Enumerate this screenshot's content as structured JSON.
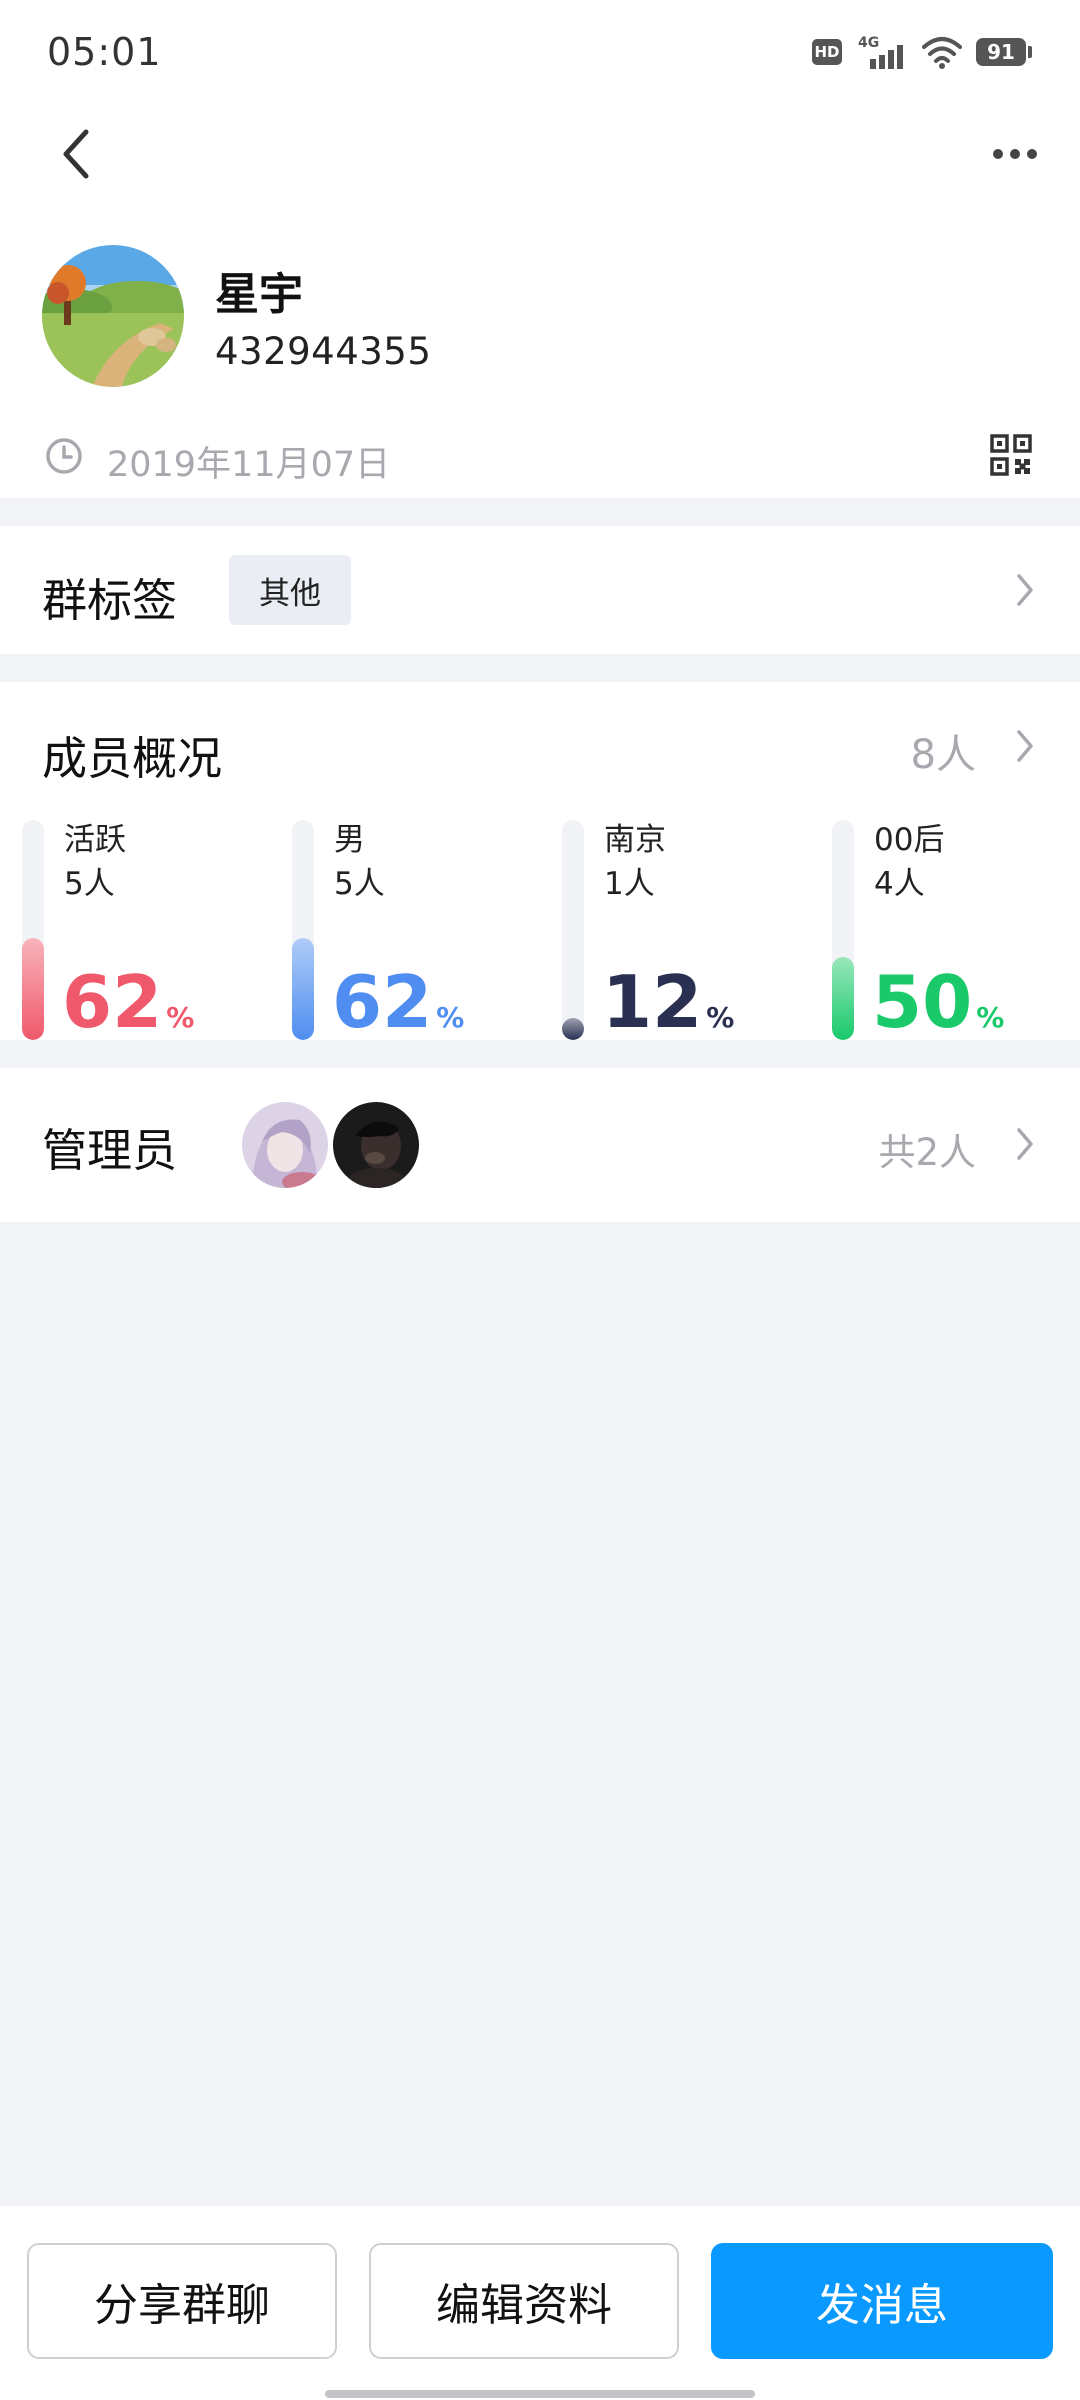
{
  "status_bar": {
    "time": "05:01",
    "hd": "HD",
    "network": "4G",
    "battery": "91"
  },
  "header": {
    "back_icon": "chevron-left-icon",
    "more_icon": "more-horizontal-icon",
    "group_name": "星宇",
    "group_id": "432944355",
    "created_date": "2019年11月07日",
    "qr_icon": "qr-code-icon"
  },
  "tags": {
    "title": "群标签",
    "tag": "其他"
  },
  "members": {
    "title": "成员概况",
    "count": "8人",
    "stats": [
      {
        "label": "活跃",
        "count": "5人",
        "percent": "62",
        "fraction": 0.62,
        "color": "#f0586b"
      },
      {
        "label": "男",
        "count": "5人",
        "percent": "62",
        "fraction": 0.62,
        "color": "#4f8ef0"
      },
      {
        "label": "南京",
        "count": "1人",
        "percent": "12",
        "fraction": 0.12,
        "color": "#2a3052"
      },
      {
        "label": "00后",
        "count": "4人",
        "percent": "50",
        "fraction": 0.5,
        "color": "#19c96a"
      }
    ],
    "percent_sign": "%"
  },
  "admins": {
    "title": "管理员",
    "total": "共2人"
  },
  "bottom": {
    "share": "分享群聊",
    "edit": "编辑资料",
    "send": "发消息"
  }
}
